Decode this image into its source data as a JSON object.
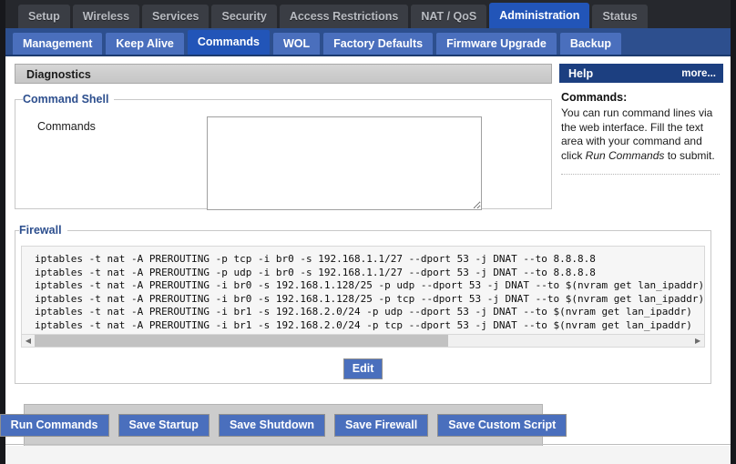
{
  "nav_top": {
    "items": [
      {
        "label": "Setup",
        "active": false
      },
      {
        "label": "Wireless",
        "active": false
      },
      {
        "label": "Services",
        "active": false
      },
      {
        "label": "Security",
        "active": false
      },
      {
        "label": "Access Restrictions",
        "active": false
      },
      {
        "label": "NAT / QoS",
        "active": false
      },
      {
        "label": "Administration",
        "active": true
      },
      {
        "label": "Status",
        "active": false
      }
    ]
  },
  "nav_sub": {
    "items": [
      {
        "label": "Management",
        "active": false
      },
      {
        "label": "Keep Alive",
        "active": false
      },
      {
        "label": "Commands",
        "active": true
      },
      {
        "label": "WOL",
        "active": false
      },
      {
        "label": "Factory Defaults",
        "active": false
      },
      {
        "label": "Firmware Upgrade",
        "active": false
      },
      {
        "label": "Backup",
        "active": false
      }
    ]
  },
  "section": {
    "title": "Diagnostics"
  },
  "command_shell": {
    "legend": "Command Shell",
    "field_label": "Commands",
    "textarea_value": "",
    "textarea_placeholder": ""
  },
  "firewall": {
    "legend": "Firewall",
    "lines": [
      "iptables -t nat -A PREROUTING -p tcp -i br0 -s 192.168.1.1/27 --dport 53 -j DNAT --to 8.8.8.8",
      "iptables -t nat -A PREROUTING -p udp -i br0 -s 192.168.1.1/27 --dport 53 -j DNAT --to 8.8.8.8",
      "iptables -t nat -A PREROUTING -i br0 -s 192.168.1.128/25 -p udp --dport 53 -j DNAT --to $(nvram get lan_ipaddr)",
      "iptables -t nat -A PREROUTING -i br0 -s 192.168.1.128/25 -p tcp --dport 53 -j DNAT --to $(nvram get lan_ipaddr)",
      "iptables -t nat -A PREROUTING -i br1 -s 192.168.2.0/24 -p udp --dport 53 -j DNAT --to $(nvram get lan_ipaddr)",
      "iptables -t nat -A PREROUTING -i br1 -s 192.168.2.0/24 -p tcp --dport 53 -j DNAT --to $(nvram get lan_ipaddr)"
    ],
    "edit_label": "Edit",
    "scroll_left_icon": "triangle-left-icon",
    "scroll_right_icon": "triangle-right-icon"
  },
  "action_buttons": [
    {
      "label": "Run Commands"
    },
    {
      "label": "Save Startup"
    },
    {
      "label": "Save Shutdown"
    },
    {
      "label": "Save Firewall"
    },
    {
      "label": "Save Custom Script"
    }
  ],
  "help": {
    "title": "Help",
    "more_label": "more...",
    "heading": "Commands:",
    "body_part1": "You can run command lines via the web interface. Fill the text area with your command and click ",
    "body_emphasis": "Run Commands",
    "body_part2": " to submit."
  },
  "colors": {
    "accent_blue": "#2255b8",
    "sub_nav_blue": "#2d4f8e",
    "tab_blue": "#4a6fbd",
    "dark_nav": "#26282d",
    "help_header": "#1c3f80",
    "section_gray": "#cccccc"
  }
}
